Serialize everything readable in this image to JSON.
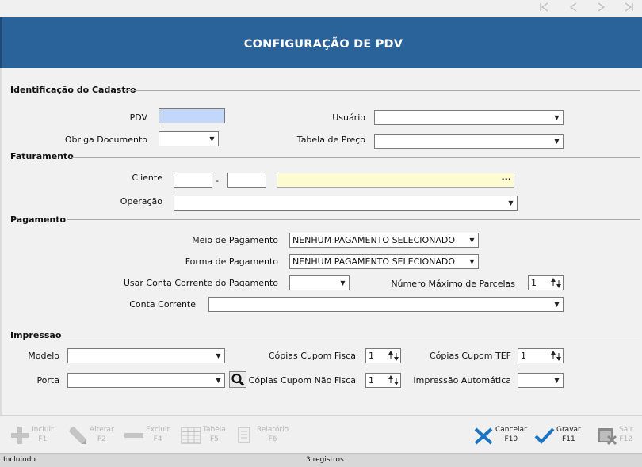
{
  "header": {
    "title": "CONFIGURAÇÃO DE PDV"
  },
  "colors": {
    "header_bg": "#2a6399",
    "pdv_field": "#c2d7fa",
    "client_name_field": "#fdfbd0",
    "accent_blue": "#1a74c4"
  },
  "sections": {
    "identificacao": "Identificação do Cadastro",
    "faturamento": "Faturamento",
    "pagamento": "Pagamento",
    "impressao": "Impressão"
  },
  "identificacao": {
    "pdv_label": "PDV",
    "pdv_value": "",
    "usuario_label": "Usuário",
    "usuario_value": "",
    "obriga_documento_label": "Obriga Documento",
    "obriga_documento_value": "",
    "tabela_preco_label": "Tabela de Preço",
    "tabela_preco_value": ""
  },
  "faturamento": {
    "cliente_label": "Cliente",
    "cliente_separator": "-",
    "cliente_code_a": "",
    "cliente_code_b": "",
    "cliente_name": "",
    "cliente_lookup": "···",
    "operacao_label": "Operação",
    "operacao_value": ""
  },
  "pagamento": {
    "meio_label": "Meio de Pagamento",
    "meio_value": "NENHUM PAGAMENTO SELECIONADO",
    "forma_label": "Forma de Pagamento",
    "forma_value": "NENHUM PAGAMENTO SELECIONADO",
    "usar_conta_label": "Usar Conta Corrente do Pagamento",
    "usar_conta_value": "",
    "num_max_parcelas_label": "Número Máximo de Parcelas",
    "num_max_parcelas_value": "1",
    "conta_corrente_label": "Conta Corrente",
    "conta_corrente_value": ""
  },
  "impressao": {
    "modelo_label": "Modelo",
    "modelo_value": "",
    "porta_label": "Porta",
    "porta_value": "",
    "copias_fiscal_label": "Cópias Cupom Fiscal",
    "copias_fiscal_value": "1",
    "copias_nao_fiscal_label": "Cópias Cupom Não Fiscal",
    "copias_nao_fiscal_value": "1",
    "copias_tef_label": "Cópias Cupom TEF",
    "copias_tef_value": "1",
    "impressao_auto_label": "Impressão Automática",
    "impressao_auto_value": ""
  },
  "toolbar": {
    "incluir": "Incluir",
    "incluir_key": "F1",
    "alterar": "Alterar",
    "alterar_key": "F2",
    "excluir": "Excluir",
    "excluir_key": "F4",
    "tabela": "Tabela",
    "tabela_key": "F5",
    "relatorio": "Relatório",
    "relatorio_key": "F6",
    "cancelar": "Cancelar",
    "cancelar_key": "F10",
    "gravar": "Gravar",
    "gravar_key": "F11",
    "sair": "Sair",
    "sair_key": "F12"
  },
  "status": {
    "mode": "Incluindo",
    "records": "3 registros"
  }
}
